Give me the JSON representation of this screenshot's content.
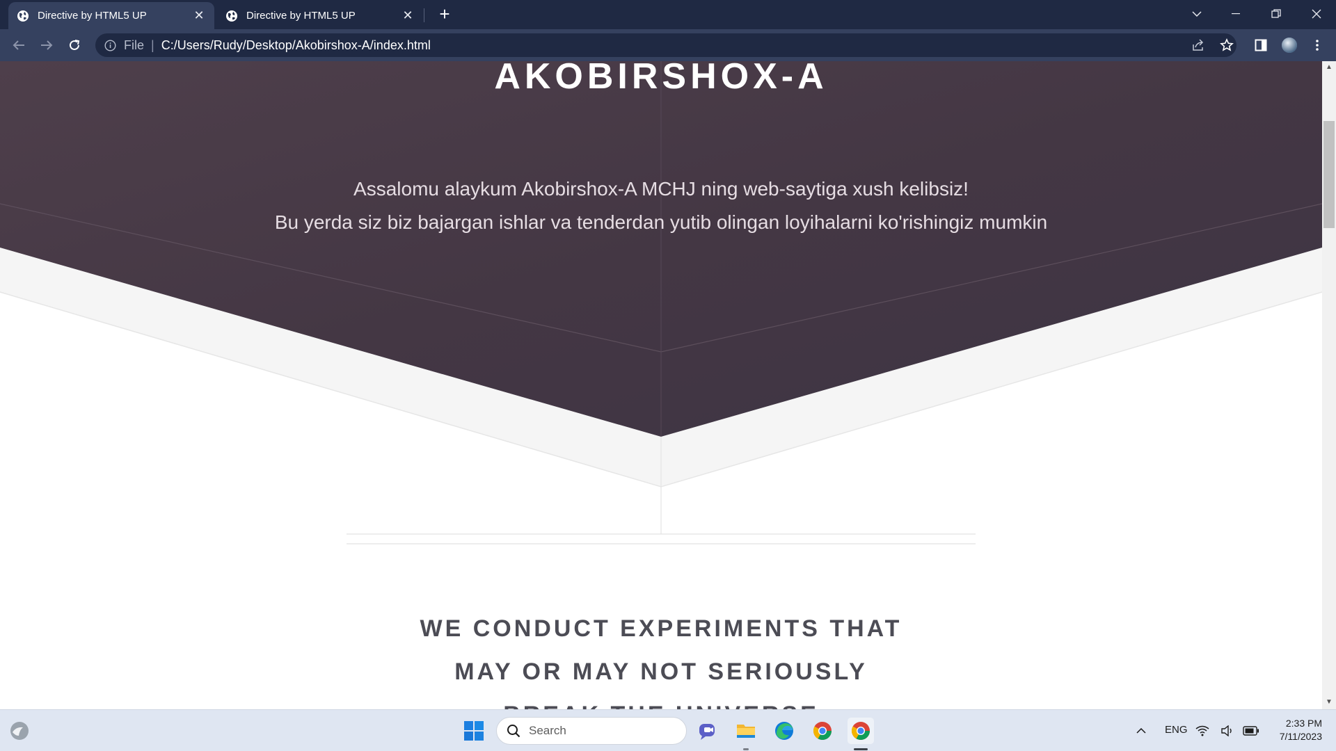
{
  "browser": {
    "tabs": [
      {
        "title": "Directive by HTML5 UP",
        "active": true
      },
      {
        "title": "Directive by HTML5 UP",
        "active": false
      }
    ],
    "address_bar": {
      "scheme_label": "File",
      "url": "C:/Users/Rudy/Desktop/Akobirshox-A/index.html"
    }
  },
  "page": {
    "header": {
      "title": "AKOBIRSHOX-A",
      "subtitle_lines": [
        "Assalomu alaykum Akobirshox-A MCHJ ning web-saytiga xush kelibsiz!",
        "Bu yerda siz biz bajargan ishlar va tenderdan yutib olingan loyihalarni ko'rishingiz mumkin"
      ]
    },
    "section": {
      "heading_lines": [
        "WE CONDUCT EXPERIMENTS THAT",
        "MAY OR MAY NOT SERIOUSLY",
        "BREAK THE UNIVERSE"
      ]
    }
  },
  "taskbar": {
    "search_placeholder": "Search",
    "language": "ENG",
    "time": "2:33 PM",
    "date": "7/11/2023",
    "apps": [
      "windows-start",
      "teams-chat",
      "file-explorer",
      "edge",
      "chrome",
      "chrome"
    ]
  },
  "colors": {
    "tab_strip": "#1f2943",
    "toolbar": "#35415f",
    "hero": "#463a47",
    "heading": "#4c4c55",
    "taskbar": "#dfe6f2"
  }
}
